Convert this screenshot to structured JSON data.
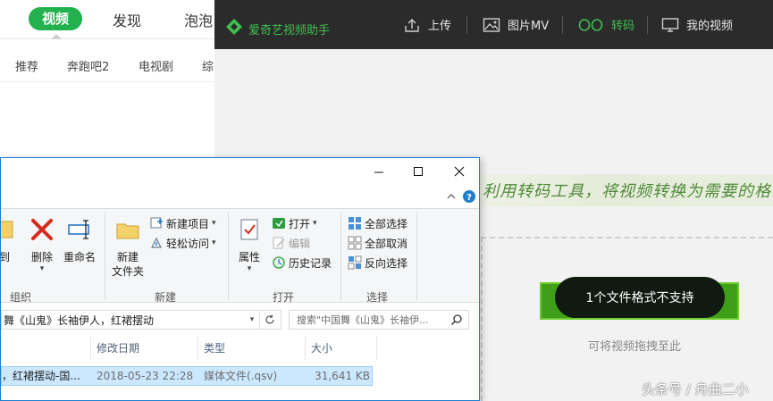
{
  "background_page": {
    "nav_active": "视频",
    "nav_items": [
      "发现",
      "泡泡"
    ],
    "subnav": [
      "推荐",
      "奔跑吧2",
      "电视剧",
      "综"
    ]
  },
  "app": {
    "title": "爱奇艺视频助手",
    "toolbar": {
      "upload": "上传",
      "photo_mv": "图片MV",
      "transcode": "转码",
      "my_videos": "我的视频"
    },
    "slogan": "利用转码工具，将视频转换为需要的格",
    "error_button": "1个文件格式不支持",
    "drag_hint": "可将视频拖拽至此",
    "accent_color": "#3fbf50"
  },
  "explorer": {
    "window_controls": {
      "minimize": "minimize-icon",
      "maximize": "maximize-icon",
      "close": "close-icon"
    },
    "ribbon": {
      "organize": {
        "copy_to": "到",
        "delete": "删除",
        "rename": "重命名",
        "group_label": "组织"
      },
      "new": {
        "new_folder_line1": "新建",
        "new_folder_line2": "文件夹",
        "new_item": "新建项目",
        "easy_access": "轻松访问",
        "group_label": "新建"
      },
      "open": {
        "properties": "属性",
        "open": "打开",
        "edit": "编辑",
        "history": "历史记录",
        "group_label": "打开"
      },
      "select": {
        "select_all": "全部选择",
        "select_none": "全部取消",
        "invert": "反向选择",
        "group_label": "选择"
      }
    },
    "address": "舞《山鬼》长袖伊人，红裙摆动",
    "search_placeholder": "搜索\"中国舞《山鬼》长袖伊...",
    "columns": {
      "date": "修改日期",
      "type": "类型",
      "size": "大小"
    },
    "files": [
      {
        "name": "，红裙摆动-国...",
        "date": "2018-05-23 22:28",
        "type": "媒体文件(.qsv)",
        "size": "31,641 KB"
      }
    ]
  },
  "watermark": "头条号 / 舟曲二小"
}
